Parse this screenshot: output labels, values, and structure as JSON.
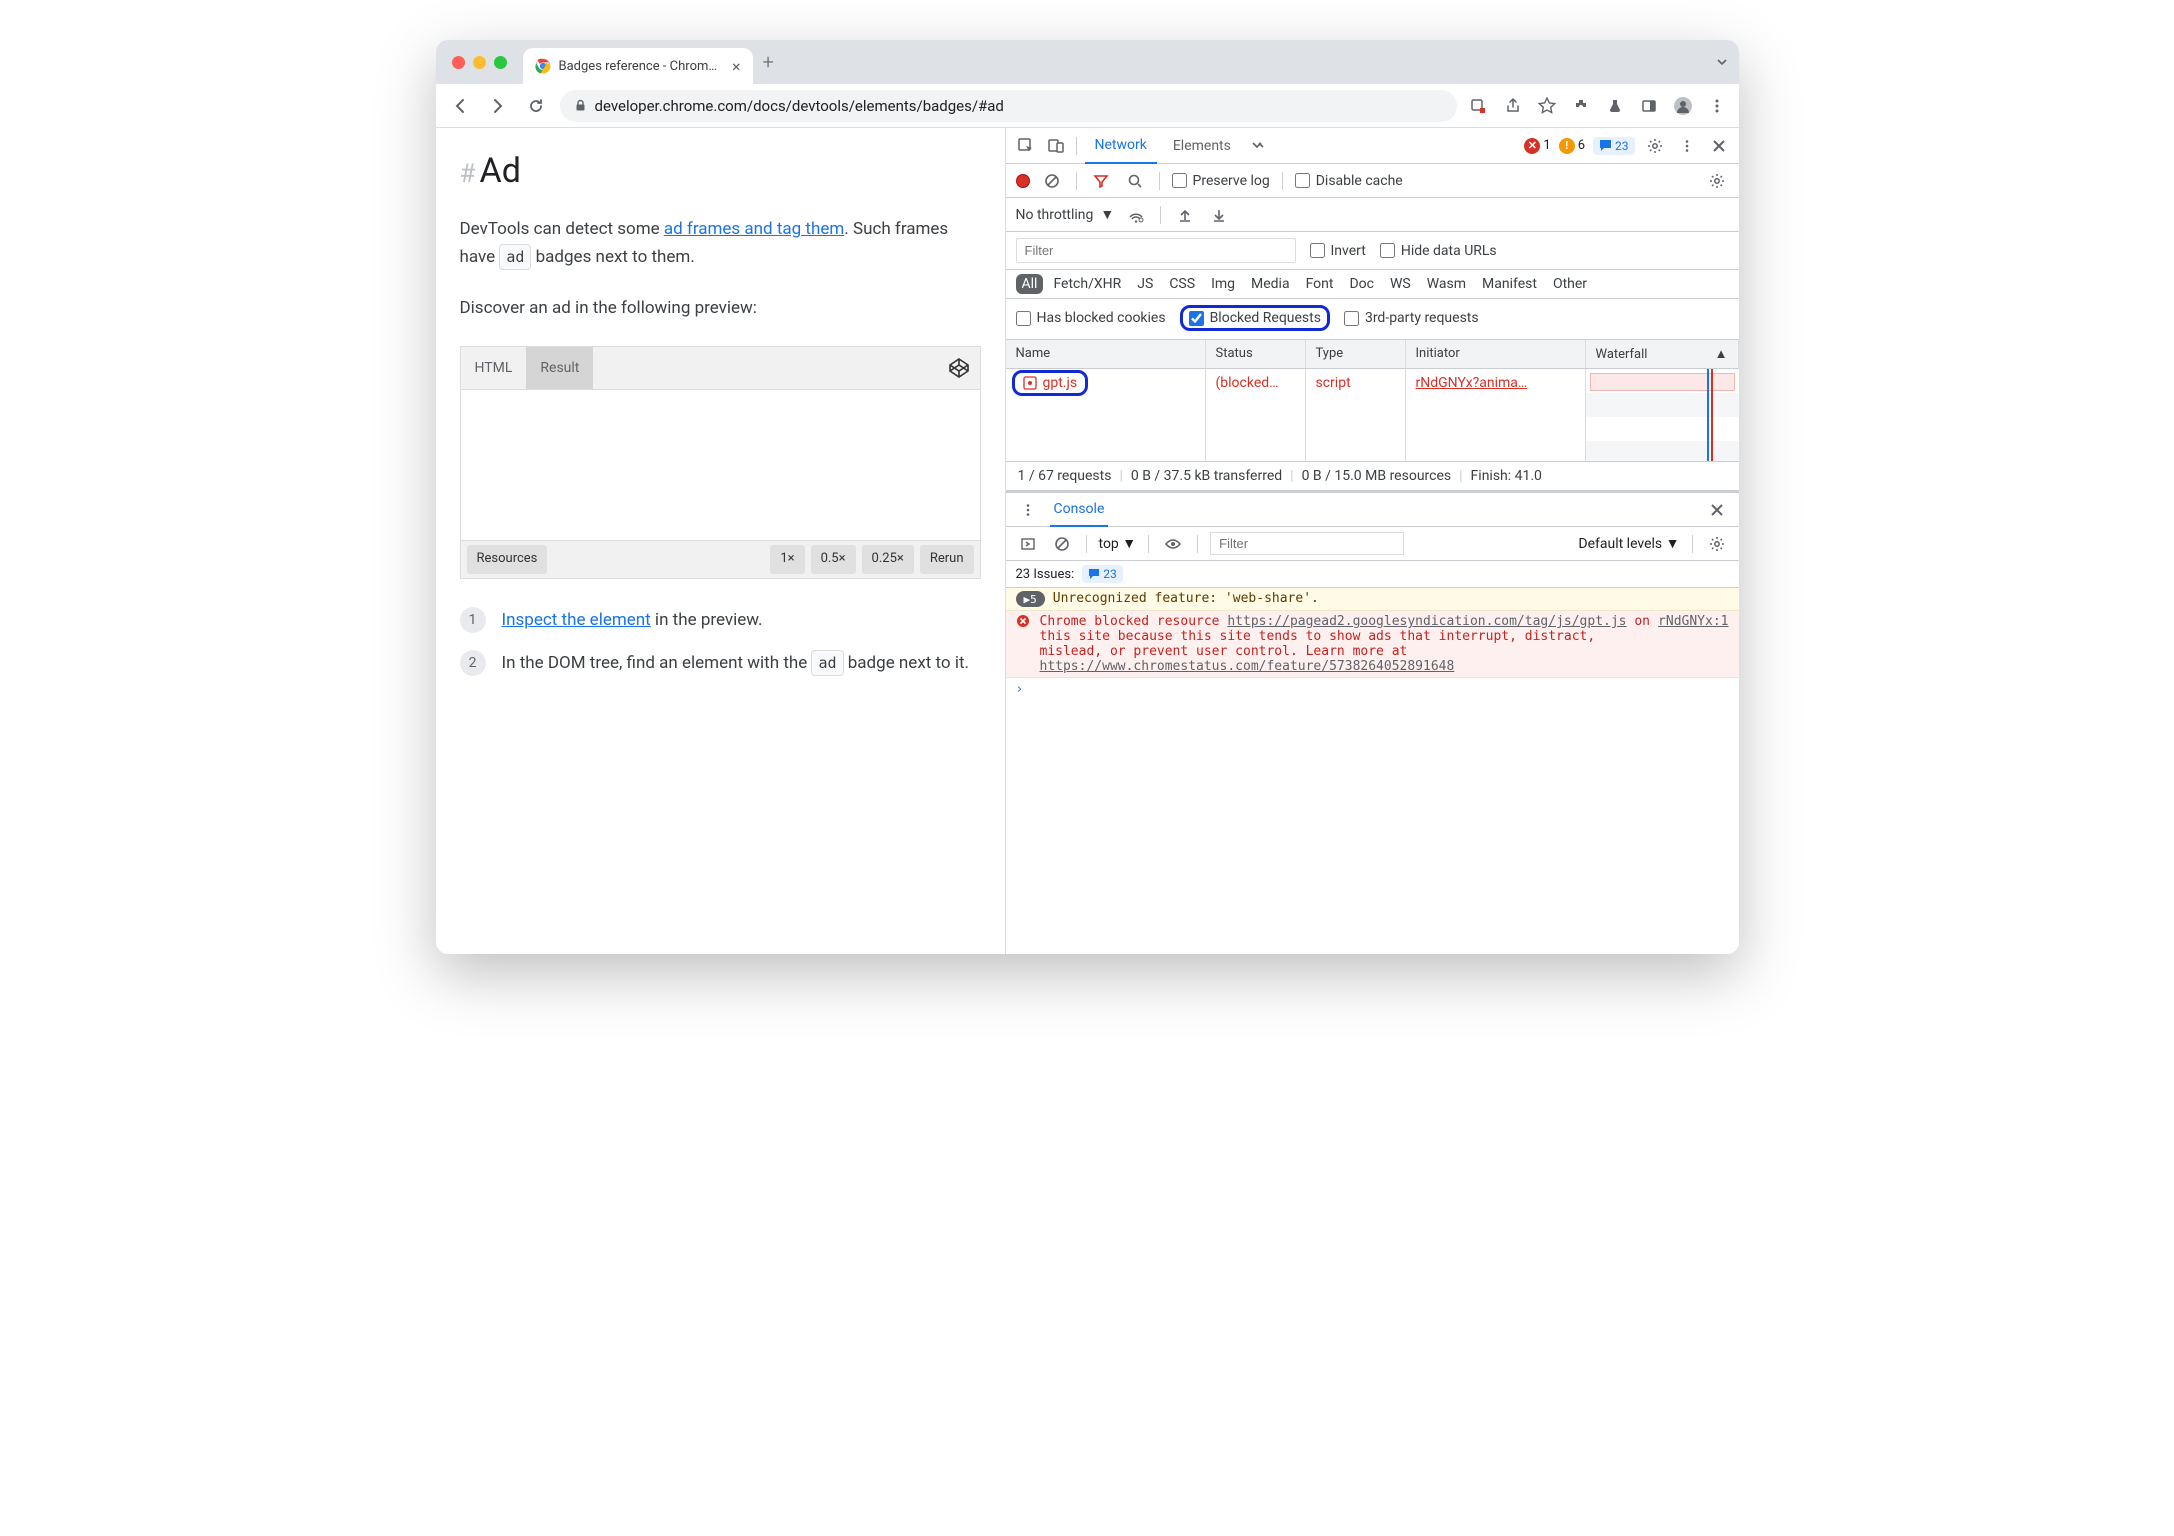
{
  "tab": {
    "title": "Badges reference - Chrome De"
  },
  "url": "developer.chrome.com/docs/devtools/elements/badges/#ad",
  "page": {
    "heading": "Ad",
    "p1a": "DevTools can detect some ",
    "p1_link": "ad frames and tag them",
    "p1b": ". Such frames have ",
    "p1_badge": "ad",
    "p1c": " badges next to them.",
    "p2": "Discover an ad in the following preview:",
    "codepen": {
      "tab_html": "HTML",
      "tab_result": "Result",
      "footer_resources": "Resources",
      "footer_1x": "1×",
      "footer_05x": "0.5×",
      "footer_025x": "0.25×",
      "footer_rerun": "Rerun"
    },
    "step1_link": "Inspect the element",
    "step1_rest": " in the preview.",
    "step2a": "In the DOM tree, find an element with the ",
    "step2_badge": "ad",
    "step2b": " badge next to it."
  },
  "devtools": {
    "tabs": {
      "network": "Network",
      "elements": "Elements"
    },
    "errors": "1",
    "warnings": "6",
    "messages": "23",
    "preserve_log": "Preserve log",
    "disable_cache": "Disable cache",
    "throttling": "No throttling",
    "filter_placeholder": "Filter",
    "invert": "Invert",
    "hide_urls": "Hide data URLs",
    "types": [
      "All",
      "Fetch/XHR",
      "JS",
      "CSS",
      "Img",
      "Media",
      "Font",
      "Doc",
      "WS",
      "Wasm",
      "Manifest",
      "Other"
    ],
    "blocked_cookies": "Has blocked cookies",
    "blocked_requests": "Blocked Requests",
    "third_party": "3rd-party requests",
    "cols": {
      "name": "Name",
      "status": "Status",
      "type": "Type",
      "initiator": "Initiator",
      "waterfall": "Waterfall"
    },
    "row": {
      "name": "gpt.js",
      "status": "(blocked…",
      "type": "script",
      "initiator": "rNdGNYx?anima…"
    },
    "status_bar": {
      "requests": "1 / 67 requests",
      "transferred": "0 B / 37.5 kB transferred",
      "resources": "0 B / 15.0 MB resources",
      "finish": "Finish: 41.0"
    }
  },
  "console": {
    "tab": "Console",
    "top": "top",
    "filter_placeholder": "Filter",
    "levels": "Default levels",
    "issues_label": "23 Issues:",
    "issues_count": "23",
    "warn_count": "5",
    "warn_text": "Unrecognized feature: 'web-share'.",
    "err_pre": "Chrome blocked resource ",
    "err_url": "https://pagead2.googlesyndication.com/tag/js/gpt.js",
    "err_mid": " on this site because this site tends to show ads that interrupt, distract, mislead, or prevent user control. Learn more at ",
    "err_link": "https://www.chromestatus.com/feature/5738264052891648",
    "err_src": "rNdGNYx:1"
  }
}
